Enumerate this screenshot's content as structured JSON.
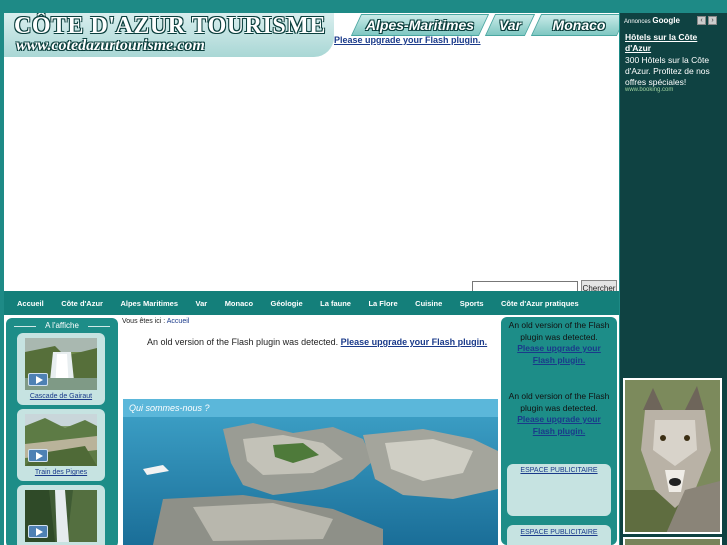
{
  "header": {
    "logo_title": "CÔTE D'AZUR TOURISME",
    "logo_url": "www.cotedazurtourisme.com",
    "region_tabs": [
      "Alpes-Maritimes",
      "Var",
      "Monaco"
    ],
    "flash_message": "Please upgrade your Flash plugin."
  },
  "search": {
    "placeholder": "",
    "button_label": "Chercher"
  },
  "nav": {
    "items": [
      "Accueil",
      "Côte d'Azur",
      "Alpes Maritimes",
      "Var",
      "Monaco",
      "Géologie",
      "La faune",
      "La Flore",
      "Cuisine",
      "Sports",
      "Côte d'Azur pratiques"
    ]
  },
  "left": {
    "heading": "A l'affiche",
    "videos": [
      {
        "caption": "Cascade de Gairaut"
      },
      {
        "caption": "Train des Pignes"
      },
      {
        "caption": ""
      }
    ]
  },
  "center": {
    "breadcrumb_prefix": "Vous êtes ici :",
    "breadcrumb_link": "Accueil",
    "flash_text": "An old version of the Flash plugin was detected.",
    "flash_link": "Please upgrade your Flash plugin.",
    "hero_title": "Qui sommes-nous ?"
  },
  "right": {
    "flash_blocks": [
      {
        "text": "An old version of the Flash plugin was detected.",
        "link": "Please upgrade your Flash plugin."
      },
      {
        "text": "An old version of the Flash plugin was detected.",
        "link": "Please upgrade your Flash plugin."
      }
    ],
    "ads": [
      "ESPACE PUBLICITAIRE",
      "ESPACE PUBLICITAIRE"
    ]
  },
  "google_ad": {
    "header_prefix": "Annonces",
    "header_brand": "Google",
    "prev_label": "‹",
    "next_label": "›",
    "link_title": "Hôtels sur la Côte d'Azur",
    "body": "300 Hôtels sur la Côte d'Azur. Profitez de nos offres spéciales!",
    "display_url": "www.booking.com"
  },
  "colors": {
    "page_background": "#1e8a86",
    "nav_bar": "#147f7a",
    "panel": "#1d8d88",
    "ad_sidebar": "#0f4242",
    "link": "#1a3a8a"
  }
}
